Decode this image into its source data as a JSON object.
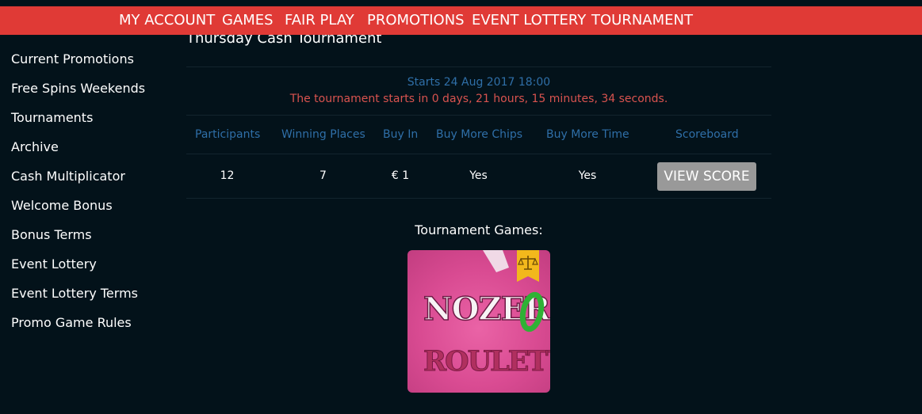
{
  "nav": {
    "items": [
      "MY ACCOUNT",
      "GAMES",
      "FAIR PLAY",
      "PROMOTIONS",
      "EVENT LOTTERY",
      "TOURNAMENT"
    ]
  },
  "sidebar": {
    "items": [
      "Current Promotions",
      "Free Spins Weekends",
      "Tournaments",
      "Archive",
      "Cash Multiplicator",
      "Welcome Bonus",
      "Bonus Terms",
      "Event Lottery",
      "Event Lottery Terms",
      "Promo Game Rules"
    ]
  },
  "tournament": {
    "title": "Thursday Cash Tournament",
    "starts": "Starts 24 Aug 2017 18:00",
    "countdown": "The tournament starts in 0 days, 21 hours, 15 minutes, 34 seconds.",
    "columns": [
      "Participants",
      "Winning Places",
      "Buy In",
      "Buy More Chips",
      "Buy More Time",
      "Scoreboard"
    ],
    "values": [
      "12",
      "7",
      "€ 1",
      "Yes",
      "Yes"
    ],
    "view_score_label": "VIEW SCORE",
    "games_label": "Tournament Games:",
    "game": {
      "name_line1": "NOZERO",
      "name_line2": "ROULETTE",
      "badge_icon": "scales-icon"
    }
  },
  "colors": {
    "nav_bg": "#e03a36",
    "page_bg": "#03121a",
    "header_text": "#2f6fa8",
    "countdown_text": "#d9534f",
    "button_bg": "#999999"
  }
}
